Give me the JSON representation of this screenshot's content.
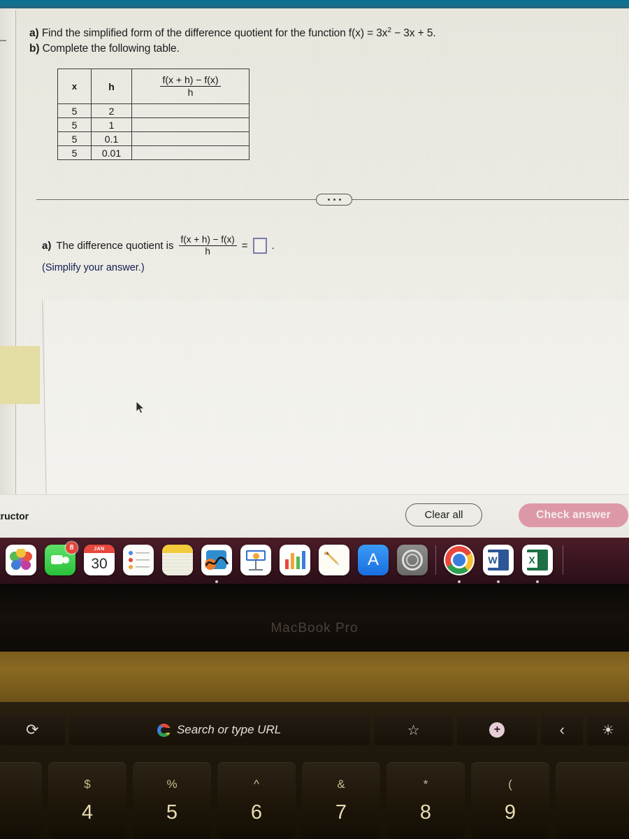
{
  "problem": {
    "line_a_prefix": "a)",
    "line_a": "Find the simplified form of the difference quotient for the function f(x) = 3x",
    "line_a_exp": "2",
    "line_a_tail": " − 3x + 5.",
    "line_b_prefix": "b)",
    "line_b": "Complete the following table."
  },
  "table": {
    "headers": {
      "x": "x",
      "h": "h",
      "quotient_num": "f(x + h) − f(x)",
      "quotient_den": "h"
    },
    "rows": [
      {
        "x": "5",
        "h": "2",
        "q": ""
      },
      {
        "x": "5",
        "h": "1",
        "q": ""
      },
      {
        "x": "5",
        "h": "0.1",
        "q": ""
      },
      {
        "x": "5",
        "h": "0.01",
        "q": ""
      }
    ]
  },
  "answer": {
    "label_prefix": "a)",
    "label": "The difference quotient is",
    "frac_num": "f(x + h) − f(x)",
    "frac_den": "h",
    "equals": "=",
    "period": ".",
    "input_value": "",
    "hint": "(Simplify your answer.)"
  },
  "appbar": {
    "instructor_text": "tructor",
    "clear_all": "Clear all",
    "check_answer": "Check answer",
    "check_answer_color": "#dd98a7"
  },
  "dock": {
    "items": [
      {
        "name": "Photos",
        "badge": "",
        "running": false
      },
      {
        "name": "FaceTime",
        "badge": "8",
        "running": false
      },
      {
        "name": "Calendar",
        "month": "JAN",
        "day": "30",
        "badge": "",
        "running": false
      },
      {
        "name": "Reminders",
        "badge": "",
        "running": false
      },
      {
        "name": "Notes",
        "badge": "",
        "running": false
      },
      {
        "name": "Freeform",
        "badge": "",
        "running": true
      },
      {
        "name": "Keynote",
        "badge": "",
        "running": false
      },
      {
        "name": "Numbers",
        "badge": "",
        "running": false
      },
      {
        "name": "Pages",
        "badge": "",
        "running": false
      },
      {
        "name": "App Store",
        "badge": "",
        "running": false
      },
      {
        "name": "System Settings",
        "badge": "",
        "running": false
      },
      {
        "name": "Google Chrome",
        "badge": "",
        "running": true
      },
      {
        "name": "Microsoft Word",
        "badge": "",
        "running": true
      },
      {
        "name": "Microsoft Excel",
        "badge": "",
        "running": true
      }
    ]
  },
  "laptop": {
    "model_label": "MacBook Pro"
  },
  "touchbar": {
    "reload_icon": "⟳",
    "url_placeholder": "Search or type URL",
    "star_icon": "☆",
    "plus_icon": "+",
    "back_icon": "‹",
    "brightness_icon": "☀"
  },
  "keyboard": {
    "keys": [
      {
        "symbol": "",
        "number": "",
        "partial": "left"
      },
      {
        "symbol": "$",
        "number": "4"
      },
      {
        "symbol": "%",
        "number": "5"
      },
      {
        "symbol": "^",
        "number": "6"
      },
      {
        "symbol": "&",
        "number": "7"
      },
      {
        "symbol": "*",
        "number": "8"
      },
      {
        "symbol": "(",
        "number": "9"
      },
      {
        "symbol": "",
        "number": "",
        "partial": "right"
      }
    ]
  }
}
